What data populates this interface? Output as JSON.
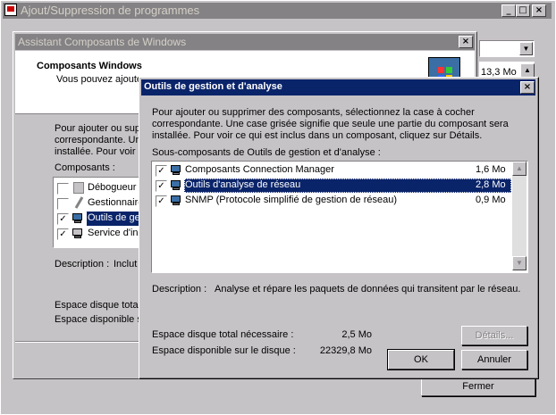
{
  "main_window": {
    "title": "Ajout/Suppression de programmes",
    "size_value": "13,3 Mo",
    "close_label": "Fermer"
  },
  "wizard": {
    "title": "Assistant Composants de Windows",
    "heading": "Composants Windows",
    "subtext": "Vous pouvez ajouter",
    "intro": [
      "Pour ajouter ou supp",
      "correspondante. Un",
      "installée. Pour voir c"
    ],
    "components_label": "Composants :",
    "components": [
      {
        "label": "Débogueur",
        "checked": false
      },
      {
        "label": "Gestionnaire",
        "checked": false
      },
      {
        "label": "Outils de ge",
        "checked": true,
        "selected": true
      },
      {
        "label": "Service d'in",
        "checked": true
      }
    ],
    "description_label": "Description :",
    "description_value": "Inclut",
    "disk_total_label": "Espace disque total",
    "disk_free_label": "Espace disponible s"
  },
  "dialog": {
    "title": "Outils de gestion et d'analyse",
    "instructions": [
      "Pour ajouter ou supprimer des composants, sélectionnez la case à cocher",
      "correspondante. Une case grisée signifie que seule une partie du composant sera",
      "installée. Pour voir ce qui est inclus dans un composant, cliquez sur Détails."
    ],
    "subcomponents_label": "Sous-composants de Outils de gestion et d'analyse :",
    "subcomponents": [
      {
        "label": "Composants Connection Manager",
        "size": "1,6 Mo",
        "checked": true
      },
      {
        "label": "Outils d'analyse de réseau",
        "size": "2,8 Mo",
        "checked": true,
        "selected": true
      },
      {
        "label": "SNMP (Protocole simplifié de gestion de réseau)",
        "size": "0,9 Mo",
        "checked": true
      }
    ],
    "description_label": "Description :",
    "description_text": "Analyse et répare les paquets de données qui transitent par le réseau.",
    "disk_total_label": "Espace disque total nécessaire :",
    "disk_total_value": "2,5 Mo",
    "disk_free_label": "Espace disponible sur le disque :",
    "disk_free_value": "22329,8 Mo",
    "details_button": "Détails...",
    "ok_button": "OK",
    "cancel_button": "Annuler"
  },
  "colors": {
    "titlebar_active": "#0a246a",
    "titlebar_inactive": "#848284",
    "desktop": "#c6c3c6"
  }
}
